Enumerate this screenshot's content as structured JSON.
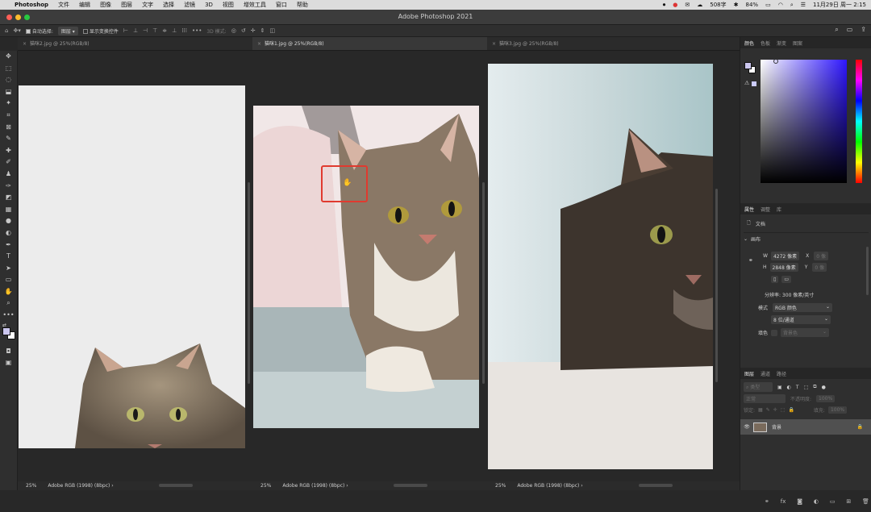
{
  "menubar": {
    "items": [
      "Photoshop",
      "文件",
      "编辑",
      "图像",
      "图层",
      "文字",
      "选择",
      "滤镜",
      "3D",
      "视图",
      "增效工具",
      "窗口",
      "帮助"
    ],
    "status": {
      "word_count": "508字",
      "battery": "84%",
      "clock": "11月29日 周一 2:15"
    }
  },
  "window": {
    "title": "Adobe Photoshop 2021"
  },
  "options_bar": {
    "auto_select_label": "自动选择:",
    "auto_select_target": "图层",
    "show_transform_label": "显示变换控件",
    "mode_3d_label": "3D 模式:"
  },
  "documents": [
    {
      "tab": "猫咪2.jpg @ 25%(RGB/8)",
      "zoom": "25%",
      "profile": "Adobe RGB (1998) (8bpc)",
      "arrow": "›"
    },
    {
      "tab": "猫咪1.jpg @ 25%(RGB/8)",
      "zoom": "25%",
      "profile": "Adobe RGB (1998) (8bpc)",
      "arrow": "›"
    },
    {
      "tab": "猫咪3.jpg @ 25%(RGB/8)",
      "zoom": "25%",
      "profile": "Adobe RGB (1998) (8bpc)",
      "arrow": "›"
    }
  ],
  "color_panel": {
    "tabs": [
      "颜色",
      "色板",
      "渐变",
      "图案"
    ],
    "foreground": "#cbc6ee",
    "background": "#ffffff"
  },
  "properties_panel": {
    "tabs": [
      "属性",
      "调整",
      "库"
    ],
    "doc_label": "文档",
    "canvas_section": "画布",
    "width_label": "W",
    "width_value": "4272 像素",
    "height_label": "H",
    "height_value": "2848 像素",
    "x_label": "X",
    "y_label": "Y",
    "x_value": "0 像",
    "y_value": "0 像",
    "resolution": "分辨率: 300 像素/英寸",
    "mode_label": "模式",
    "mode_value": "RGB 颜色",
    "depth_value": "8 位/通道",
    "fill_label": "填色",
    "fill_value": "背景色"
  },
  "layers_panel": {
    "tabs": [
      "图层",
      "通道",
      "路径"
    ],
    "filter_kind": "类型",
    "blend_mode": "正常",
    "opacity_label": "不透明度:",
    "opacity_value": "100%",
    "lock_label": "锁定:",
    "fill_label": "填充:",
    "fill_value": "100%",
    "layers": [
      {
        "name": "背景",
        "visible": true,
        "locked": true
      }
    ]
  }
}
